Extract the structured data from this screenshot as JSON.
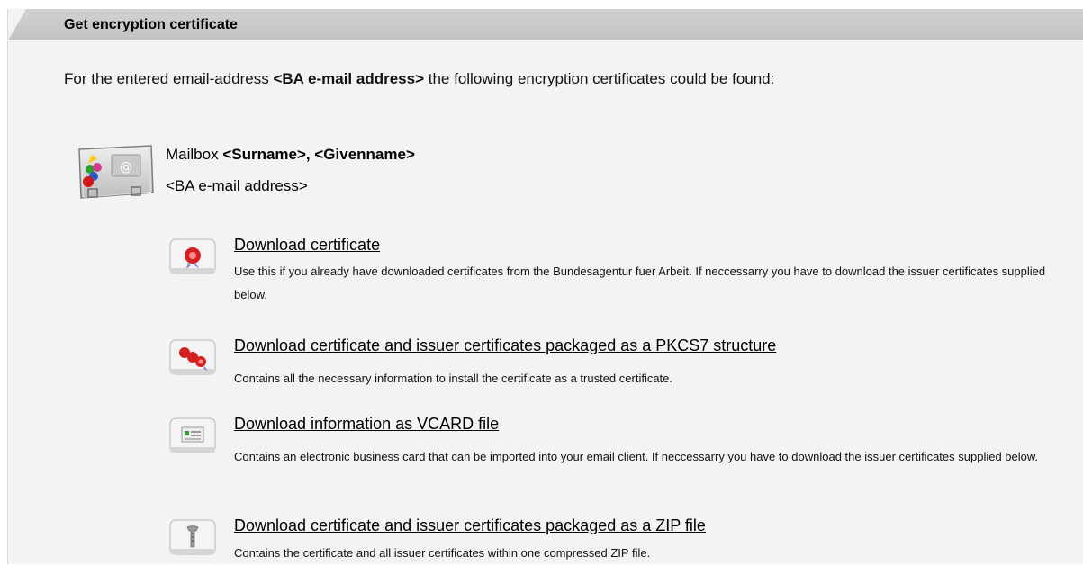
{
  "panel": {
    "title": "Get encryption certificate",
    "intro_prefix": "For the entered email-address ",
    "intro_email": "<BA e-mail address>",
    "intro_suffix": " the following encryption certificates could be found:"
  },
  "mailbox": {
    "prefix": "Mailbox ",
    "name": "<Surname>, <Givenname>",
    "address": "<BA e-mail address>",
    "icon": "business-card-icon"
  },
  "options": [
    {
      "label": "Download certificate",
      "description": "Use this if you already have downloaded certificates from the Bundesagentur fuer Arbeit. If neccessarry you have to download the issuer certificates supplied below.",
      "icon": "certificate-seal-icon"
    },
    {
      "label": "Download certificate and issuer certificates packaged as a PKCS7 structure",
      "description": "Contains all the necessary information to install the certificate as a trusted certificate.",
      "icon": "certificate-chain-icon"
    },
    {
      "label": "Download information as VCARD file",
      "description": "Contains an electronic business card that can be imported into your email client. If neccessarry you have to download the issuer certificates supplied below.",
      "icon": "vcard-icon"
    },
    {
      "label": "Download certificate and issuer certificates packaged as a ZIP file",
      "description": "Contains the certificate and all issuer certificates within one compressed ZIP file.",
      "icon": "zip-file-icon"
    }
  ]
}
